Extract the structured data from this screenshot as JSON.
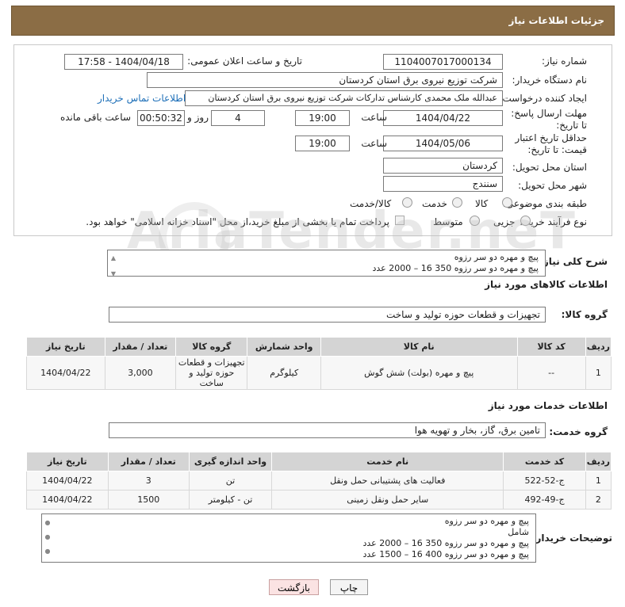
{
  "header": {
    "title": "جزئیات اطلاعات نیاز"
  },
  "form": {
    "need_number_label": "شماره نیاز:",
    "need_number": "1104007017000134",
    "announce_label": "تاریخ و ساعت اعلان عمومی:",
    "announce_value": "1404/04/18 - 17:58",
    "buyer_label": "نام دستگاه خریدار:",
    "buyer_value": "شرکت توزیع نیروی برق استان کردستان",
    "creator_label": "ایجاد کننده درخواست:",
    "creator_value": "عبدالله ملک محمدی کارشناس تدارکات شرکت توزیع نیروی برق استان کردستان",
    "contact_link": "اطلاعات تماس خریدار",
    "deadline_label": "مهلت ارسال پاسخ: تا تاریخ:",
    "deadline_date": "1404/04/22",
    "hour_label": "ساعت",
    "deadline_hour": "19:00",
    "days_value": "4",
    "days_label": "روز و",
    "remaining_time": "00:50:32",
    "remaining_label": "ساعت باقی مانده",
    "validity_label": "حداقل تاریخ اعتبار قیمت: تا تاریخ:",
    "validity_date": "1404/05/06",
    "validity_hour": "19:00",
    "province_label": "استان محل تحویل:",
    "province_value": "کردستان",
    "city_label": "شهر محل تحویل:",
    "city_value": "سنندج",
    "category_label": "طبقه بندی موضوعی:",
    "category_options": [
      "کالا",
      "خدمت",
      "کالا/خدمت"
    ],
    "process_label": "نوع فرآیند خرید :",
    "process_options": [
      "جزیی",
      "متوسط"
    ],
    "payment_note": "پرداخت تمام یا بخشی از مبلغ خرید،از محل \"اسناد خزانه اسلامی\" خواهد بود."
  },
  "summary": {
    "label": "شرح کلی نیاز:",
    "line1": "پیچ و مهره دو سر رزوه",
    "line2": "پیچ و مهره دو سر رزوه 350   16 – 2000 عدد"
  },
  "goods": {
    "section_title": "اطلاعات کالاهای مورد نیاز",
    "group_label": "گروه کالا:",
    "group_value": "تجهیزات و قطعات حوزه تولید و ساخت",
    "columns": [
      "ردیف",
      "کد کالا",
      "نام کالا",
      "واحد شمارش",
      "گروه کالا",
      "تعداد / مقدار",
      "تاریخ نیاز"
    ],
    "rows": [
      {
        "row": "1",
        "code": "--",
        "name": "پیچ و مهره (بولت) شش گوش",
        "unit": "کیلوگرم",
        "group": "تجهیزات و قطعات حوزه تولید و ساخت",
        "qty": "3,000",
        "date": "1404/04/22"
      }
    ]
  },
  "services": {
    "section_title": "اطلاعات خدمات مورد نیاز",
    "group_label": "گروه خدمت:",
    "group_value": "تامین برق، گاز، بخار و تهویه هوا",
    "columns": [
      "ردیف",
      "کد خدمت",
      "نام خدمت",
      "واحد اندازه گیری",
      "تعداد / مقدار",
      "تاریخ نیاز"
    ],
    "rows": [
      {
        "row": "1",
        "code": "ج-52-522",
        "name": "فعالیت های پشتیبانی حمل ونقل",
        "unit": "تن",
        "qty": "3",
        "date": "1404/04/22"
      },
      {
        "row": "2",
        "code": "ج-49-492",
        "name": "سایر حمل ونقل زمینی",
        "unit": "تن - کیلومتر",
        "qty": "1500",
        "date": "1404/04/22"
      }
    ]
  },
  "notes": {
    "label": "توضیحات خریدار:",
    "lines": [
      "پیچ و مهره دو سر رزوه",
      "شامل",
      "پیچ و مهره دو سر رزوه 350   16 – 2000 عدد",
      "پیچ و مهره دو سر رزوه 400   16 – 1500 عدد"
    ]
  },
  "buttons": {
    "print": "چاپ",
    "back": "بازگشت"
  },
  "watermark": "AriaTender.neT"
}
